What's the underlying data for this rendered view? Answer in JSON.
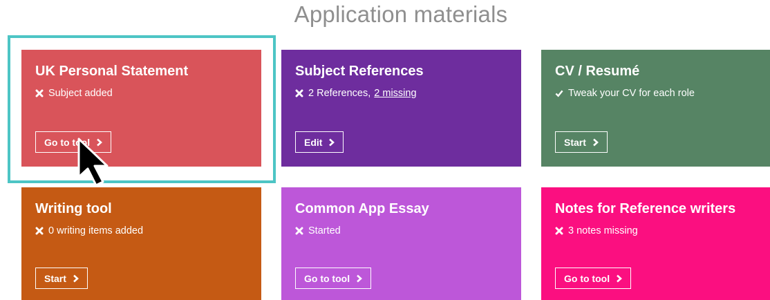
{
  "page": {
    "title": "Application materials"
  },
  "cards": [
    {
      "title": "UK Personal Statement",
      "status_icon": "cross-icon",
      "status_text": "Subject added",
      "status_link": "",
      "button_label": "Go to tool",
      "color": "#d9545a"
    },
    {
      "title": "Subject References",
      "status_icon": "cross-icon",
      "status_text": "2 References,",
      "status_link": "2 missing",
      "button_label": "Edit",
      "color": "#6e2d9e"
    },
    {
      "title": "CV / Resumé",
      "status_icon": "check-icon",
      "status_text": "Tweak your CV for each role",
      "status_link": "",
      "button_label": "Start",
      "color": "#568464"
    },
    {
      "title": "Writing tool",
      "status_icon": "cross-icon",
      "status_text": "0 writing items added",
      "status_link": "",
      "button_label": "Start",
      "color": "#c55a14"
    },
    {
      "title": "Common App Essay",
      "status_icon": "cross-icon",
      "status_text": "Started",
      "status_link": "",
      "button_label": "Go to tool",
      "color": "#bd57d9"
    },
    {
      "title": "Notes for Reference writers",
      "status_icon": "cross-icon",
      "status_text": "3 notes missing",
      "status_link": "",
      "button_label": "Go to tool",
      "color": "#fb0f80"
    }
  ],
  "highlight": {
    "color": "#4dc5c5"
  }
}
